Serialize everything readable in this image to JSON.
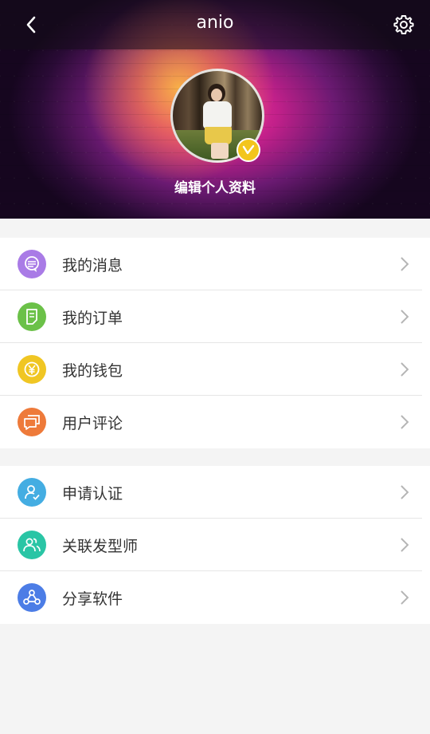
{
  "header": {
    "title": "anio",
    "back_icon": "chevron-left-icon",
    "settings_icon": "gear-icon",
    "edit_profile_label": "编辑个人资料",
    "badge_icon": "v-verified-icon",
    "badge_color": "#f3c51c"
  },
  "menu_group_1": [
    {
      "label": "我的消息",
      "icon": "message-bubble-icon",
      "color": "#a97be6"
    },
    {
      "label": "我的订单",
      "icon": "order-document-icon",
      "color": "#6bc148"
    },
    {
      "label": "我的钱包",
      "icon": "yen-coin-icon",
      "color": "#f0c623"
    },
    {
      "label": "用户评论",
      "icon": "comments-icon",
      "color": "#ee7a3a"
    }
  ],
  "menu_group_2": [
    {
      "label": "申请认证",
      "icon": "user-verify-icon",
      "color": "#44ade2"
    },
    {
      "label": "关联发型师",
      "icon": "users-icon",
      "color": "#2ac5a5"
    },
    {
      "label": "分享软件",
      "icon": "share-icon",
      "color": "#4c7de6"
    }
  ],
  "colors": {
    "background": "#f4f4f4",
    "row_text": "#333333",
    "chevron": "#b5b5b5"
  }
}
